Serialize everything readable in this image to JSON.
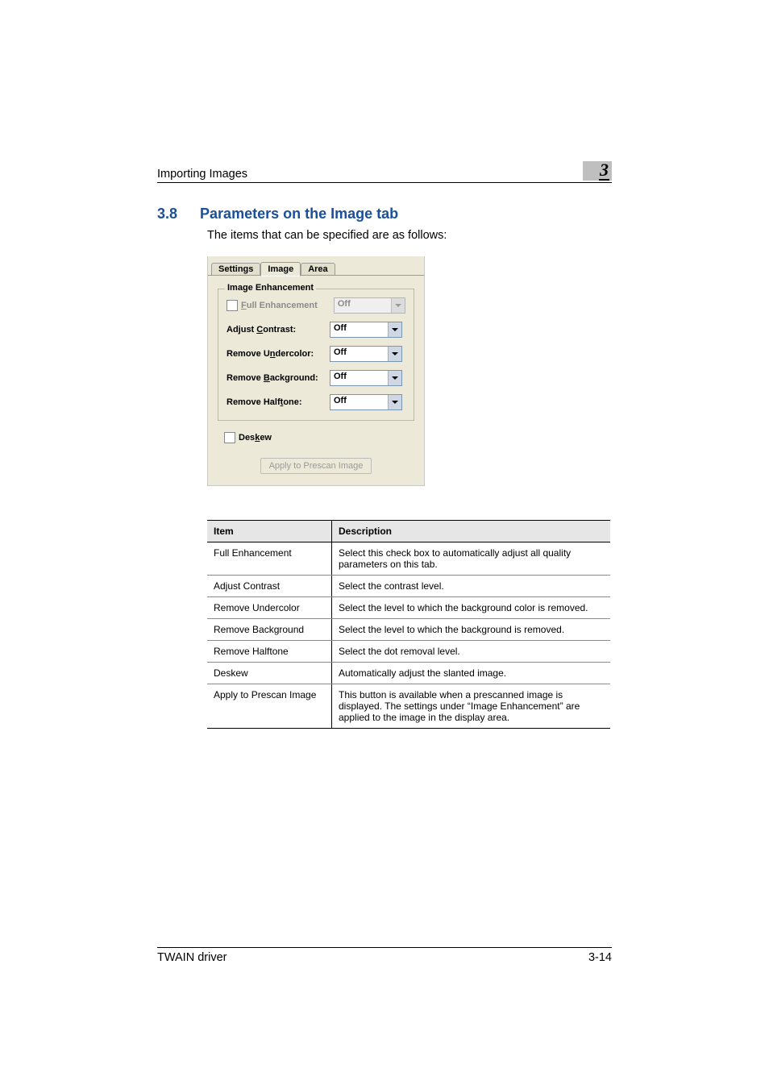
{
  "header": {
    "running_title": "Importing Images",
    "chapter_number": "3"
  },
  "section": {
    "number": "3.8",
    "title": "Parameters on the Image tab",
    "intro": "The items that can be specified are as follows:"
  },
  "dialog": {
    "tabs": {
      "settings": "Settings",
      "image": "Image",
      "area": "Area"
    },
    "group_title": "Image Enhancement",
    "rows": {
      "full_enhancement": {
        "label_pre": "",
        "label_ul": "F",
        "label_post": "ull Enhancement",
        "value": "Off"
      },
      "adjust_contrast": {
        "label_pre": "Adjust ",
        "label_ul": "C",
        "label_post": "ontrast:",
        "value": "Off"
      },
      "remove_undercolor": {
        "label_pre": "Remove U",
        "label_ul": "n",
        "label_post": "dercolor:",
        "value": "Off"
      },
      "remove_background": {
        "label_pre": "Remove ",
        "label_ul": "B",
        "label_post": "ackground:",
        "value": "Off"
      },
      "remove_halftone": {
        "label_pre": "Remove Half",
        "label_ul": "t",
        "label_post": "one:",
        "value": "Off"
      }
    },
    "deskew": {
      "label_pre": "Des",
      "label_ul": "k",
      "label_post": "ew"
    },
    "apply_button": "Apply to Prescan Image"
  },
  "table": {
    "head": {
      "item": "Item",
      "desc": "Description"
    },
    "rows": [
      {
        "item": "Full Enhancement",
        "desc": "Select this check box to automatically adjust all quality parameters on this tab."
      },
      {
        "item": "Adjust Contrast",
        "desc": "Select the contrast level."
      },
      {
        "item": "Remove Undercolor",
        "desc": "Select the level to which the background color is removed."
      },
      {
        "item": "Remove Background",
        "desc": "Select the level to which the background is removed."
      },
      {
        "item": "Remove Halftone",
        "desc": "Select the dot removal level."
      },
      {
        "item": "Deskew",
        "desc": "Automatically adjust the slanted image."
      },
      {
        "item": "Apply to Prescan Image",
        "desc": "This button is available when a prescanned image is displayed. The settings under “Image Enhancement” are applied to the image in the display area."
      }
    ]
  },
  "footer": {
    "product": "TWAIN driver",
    "page": "3-14"
  }
}
